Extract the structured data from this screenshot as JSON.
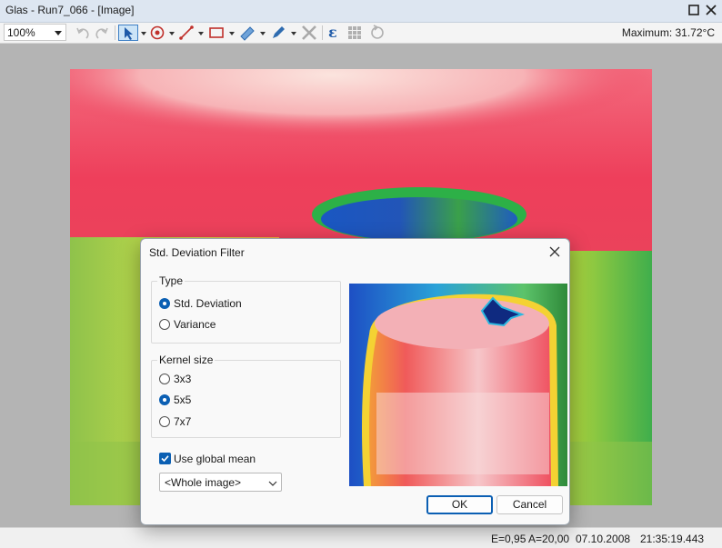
{
  "window": {
    "title": "Glas - Run7_066 - [Image]"
  },
  "toolbar": {
    "zoom_value": "100%",
    "maximum_label": "Maximum: 31.72°C",
    "icons": [
      "undo-icon",
      "redo-icon",
      "pointer-icon",
      "spot-icon",
      "line-icon",
      "rectangle-icon",
      "ruler-icon",
      "pencil-icon",
      "delete-icon",
      "emissivity-icon",
      "grid-icon",
      "rotate-icon"
    ]
  },
  "status": {
    "emissivity": "E=0,95 A=20,00",
    "date": "07.10.2008",
    "time": "21:35:19.443"
  },
  "dialog": {
    "title": "Std. Deviation Filter",
    "type_group": {
      "legend": "Type",
      "options": [
        "Std. Deviation",
        "Variance"
      ],
      "selected": "Std. Deviation"
    },
    "kernel_group": {
      "legend": "Kernel size",
      "options": [
        "3x3",
        "5x5",
        "7x7"
      ],
      "selected": "5x5"
    },
    "use_global_mean": {
      "label": "Use global mean",
      "checked": true
    },
    "region_select": {
      "value": "<Whole image>"
    },
    "ok_label": "OK",
    "cancel_label": "Cancel"
  },
  "colors": {
    "accent": "#0b5fb3",
    "title_bar": "#dde6f1",
    "workspace": "#b4b4b4"
  }
}
